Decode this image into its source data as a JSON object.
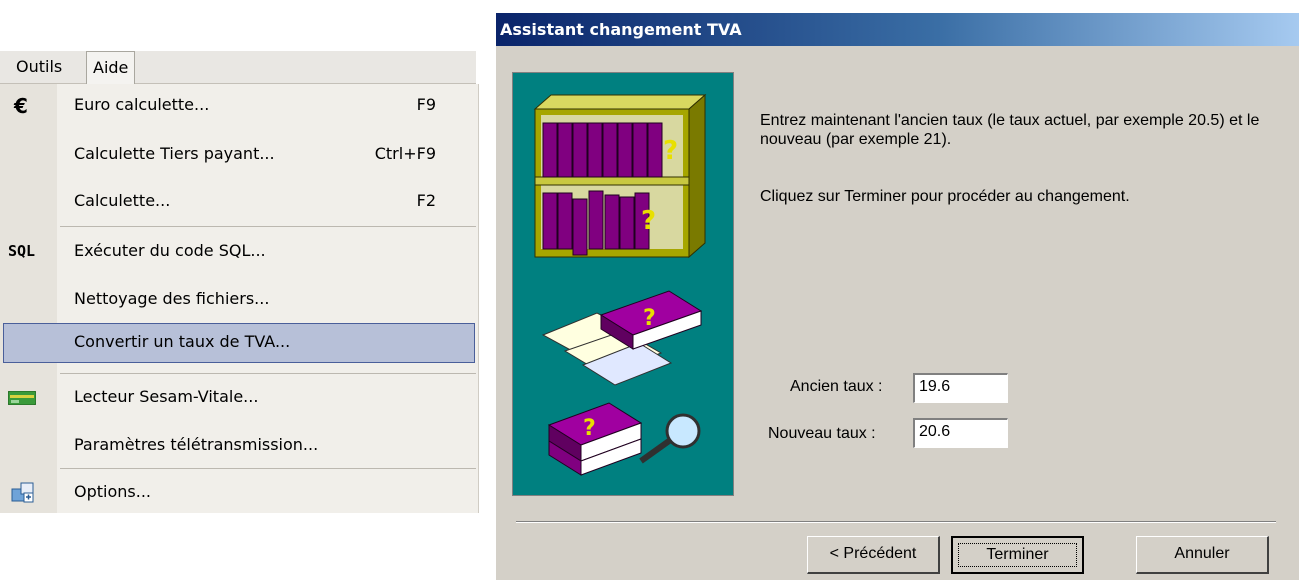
{
  "menubar": {
    "items": [
      "Outils",
      "Aide"
    ]
  },
  "menu": {
    "items": [
      {
        "label": "Euro calculette...",
        "shortcut": "F9",
        "icon": "€"
      },
      {
        "label": "Calculette Tiers payant...",
        "shortcut": "Ctrl+F9"
      },
      {
        "label": "Calculette...",
        "shortcut": "F2"
      },
      {
        "label": "Exécuter du code SQL...",
        "icon": "SQL"
      },
      {
        "label": "Nettoyage des fichiers..."
      },
      {
        "label": "Convertir un taux de TVA..."
      },
      {
        "label": "Lecteur Sesam-Vitale..."
      },
      {
        "label": "Paramètres télétransmission..."
      },
      {
        "label": "Options..."
      }
    ]
  },
  "dialog": {
    "title": "Assistant changement TVA",
    "instruction": "Entrez maintenant l'ancien taux (le taux actuel, par exemple 20.5) et le nouveau (par exemple 21).",
    "finish_hint": "Cliquez sur Terminer pour procéder au changement.",
    "old_rate_label": "Ancien taux :",
    "old_rate_value": "19.6",
    "new_rate_label": "Nouveau taux :",
    "new_rate_value": "20.6",
    "buttons": {
      "previous": "< Précédent",
      "finish": "Terminer",
      "cancel": "Annuler"
    }
  },
  "colors": {
    "teal_panel": "#008080",
    "highlight": "#b7c0d8",
    "dialog_bg": "#d4d0c8"
  }
}
